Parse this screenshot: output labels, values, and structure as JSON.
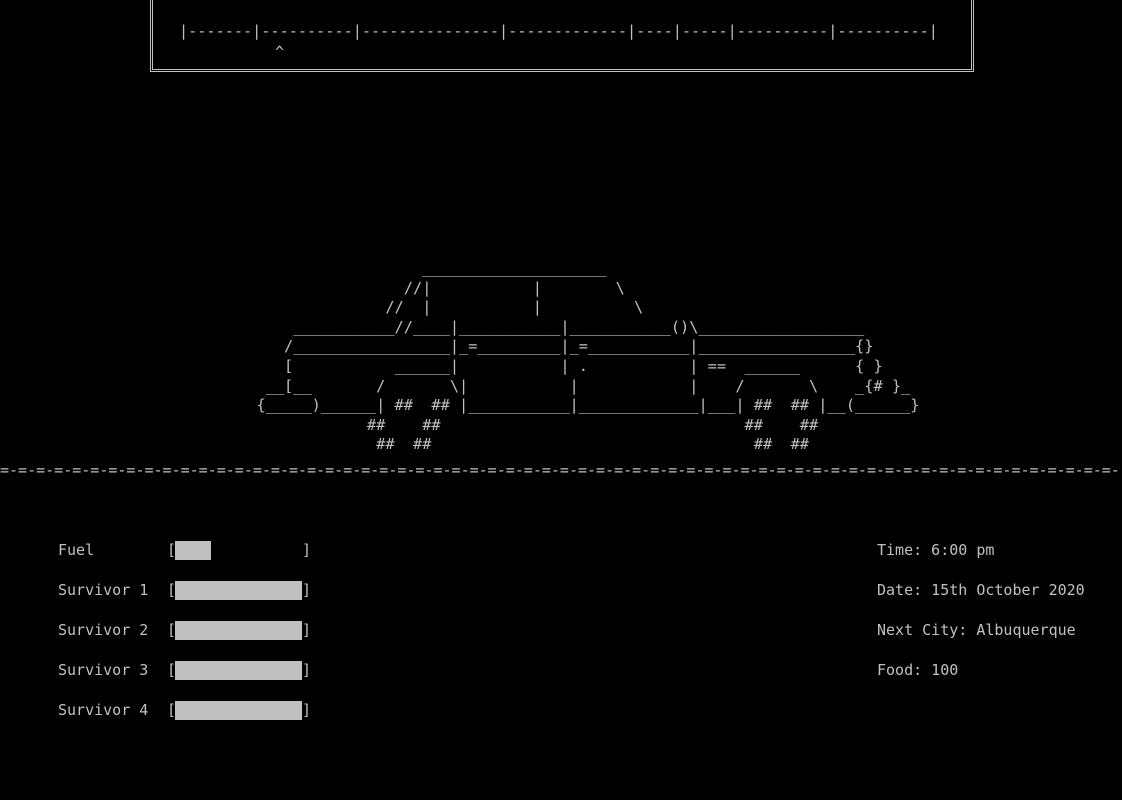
{
  "map": {
    "route": "|-------|----------|---------------|-------------|----|-----|----------|----------|",
    "marker": "^"
  },
  "car_art": "                    ____________________\n                  //|           |        \\\n                //  |           |          \\\n      ___________//____|___________|___________()\\__________________\n     /_________________|_=_________|_=___________|_________________{}\n     [           ______|           | .           | ==  ______      { }\n   __[__       /       \\|           |            |    /       \\    _{# }_\n  {_____)______| ##  ## |___________|_____________|___| ##  ## |__(______}\n              ##    ##                                 ##    ##\n               ##  ##                                   ##  ##",
  "road": "=-=-=-=-=-=-=-=-=-=-=-=-=-=-=-=-=-=-=-=-=-=-=-=-=-=-=-=-=-=-=-=-=-=-=-=-=-=-=-=-=-=-=-=-=-=-=-=-=-=-=-=-=-=-=-=-=-=-=-=-=-=-=-=-=-",
  "stats": {
    "bracket_open": "[",
    "bracket_close": "]",
    "fuel": {
      "label": "Fuel",
      "level": 0.28
    },
    "survivors": [
      {
        "label": "Survivor 1",
        "level": 1.0
      },
      {
        "label": "Survivor 2",
        "level": 1.0
      },
      {
        "label": "Survivor 3",
        "level": 1.0
      },
      {
        "label": "Survivor 4",
        "level": 1.0
      }
    ]
  },
  "info": {
    "time": "Time: 6:00 pm",
    "date": "Date: 15th October 2020",
    "next_city": "Next City: Albuquerque",
    "food": "Food: 100"
  },
  "colors": {
    "background": "#000000",
    "foreground": "#c0c0c0"
  }
}
